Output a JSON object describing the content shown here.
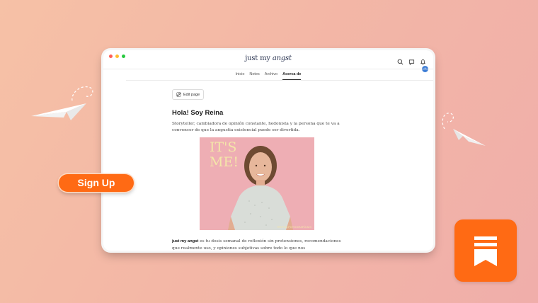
{
  "window": {
    "dots": [
      "#ff5f56",
      "#ffbd2e",
      "#27c93f"
    ]
  },
  "site": {
    "brand_plain": "just my ",
    "brand_italic": "angst",
    "notification_count": "1"
  },
  "nav": {
    "tabs": [
      "Inicio",
      "Notes",
      "Archivo",
      "Acerca de"
    ],
    "active": "Acerca de"
  },
  "page": {
    "edit_label": "Edit page",
    "title": "Hola! Soy Reina",
    "intro": "Storyteller, cambiadora de opinión constante, hedonista y la persona que te va a convencer de que la angustia existencial puede ser divertida.",
    "photo_text_line1": "IT'S",
    "photo_text_line2": "ME!",
    "photo_credit": "TRISTIA FOTOGRAFÍA MX",
    "body_bold": "just my angst",
    "body_text": " es tu dosis semanal de reflexión sin pretensiones, recomendaciones que realmente uso, y opiniones subjetivas sobre todo lo que nos"
  },
  "cta": {
    "signup_label": "Sign Up"
  },
  "colors": {
    "accent": "#ff6a14",
    "badge": "#3a7bd5",
    "photo_bg": "#eeaeb4"
  }
}
